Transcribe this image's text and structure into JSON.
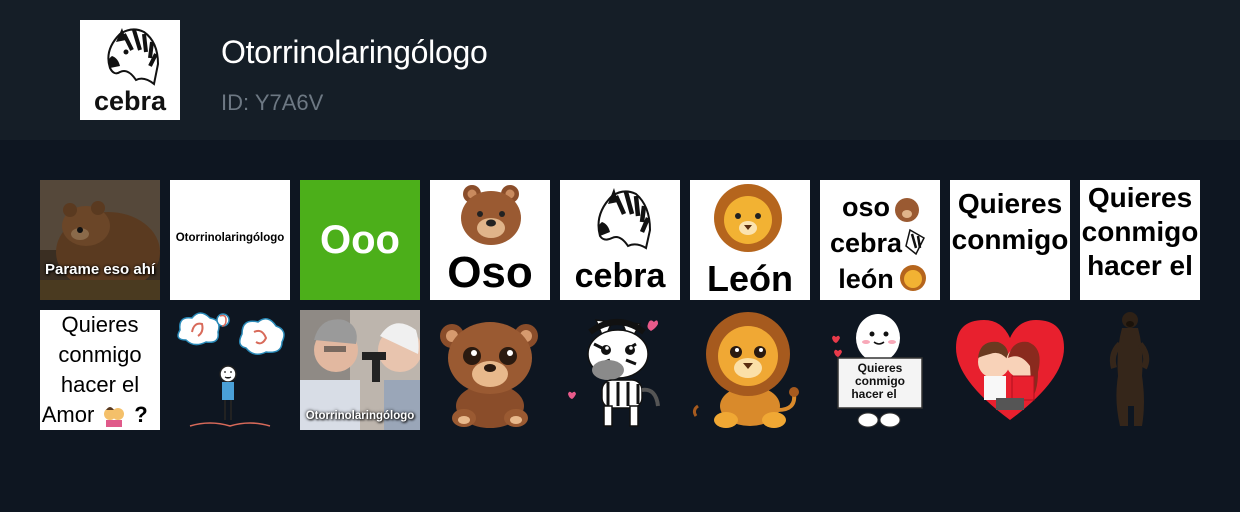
{
  "pack": {
    "title": "Otorrinolaringólogo",
    "id_text": "ID: Y7A6V",
    "icon_caption": "cebra"
  },
  "stickers": {
    "row1": [
      {
        "caption": "Parame eso ahí",
        "icon": "bear-photo"
      },
      {
        "caption": "Otorrinolaringólogo",
        "icon": "text-only"
      },
      {
        "caption": "Ooo",
        "icon": "text-on-green"
      },
      {
        "caption": "Oso",
        "icon": "bear-emoji"
      },
      {
        "caption": "cebra",
        "icon": "zebra-icon"
      },
      {
        "caption": "León",
        "icon": "lion-emoji"
      },
      {
        "line1": "oso",
        "line2": "cebra",
        "line3": "león",
        "icon": "animal-list"
      },
      {
        "line1": "Quieres",
        "line2": "conmigo",
        "icon": "text-only"
      },
      {
        "line1": "Quieres",
        "line2": "conmigo",
        "line3": "hacer el",
        "icon": "text-only"
      }
    ],
    "row2": [
      {
        "line1": "Quieres",
        "line2": "conmigo",
        "line3": "hacer el",
        "line4": "Amor",
        "suffix": "?",
        "icon": "couple-kiss-emoji"
      },
      {
        "icon": "ear-nose-throat-doodle"
      },
      {
        "caption": "Otorrinolaringólogo",
        "icon": "doctor-photo"
      },
      {
        "icon": "cartoon-bear"
      },
      {
        "icon": "cartoon-zebra"
      },
      {
        "icon": "cartoon-lion"
      },
      {
        "line1": "Quieres",
        "line2": "conmigo",
        "line3": "hacer el",
        "icon": "ghost-sign"
      },
      {
        "icon": "heart-couple"
      },
      {
        "icon": "standing-bear"
      }
    ]
  },
  "colors": {
    "background": "#0e1621",
    "header": "#151e27",
    "title": "#ffffff",
    "id": "#6d7883",
    "green_tile": "#4caf1a"
  }
}
